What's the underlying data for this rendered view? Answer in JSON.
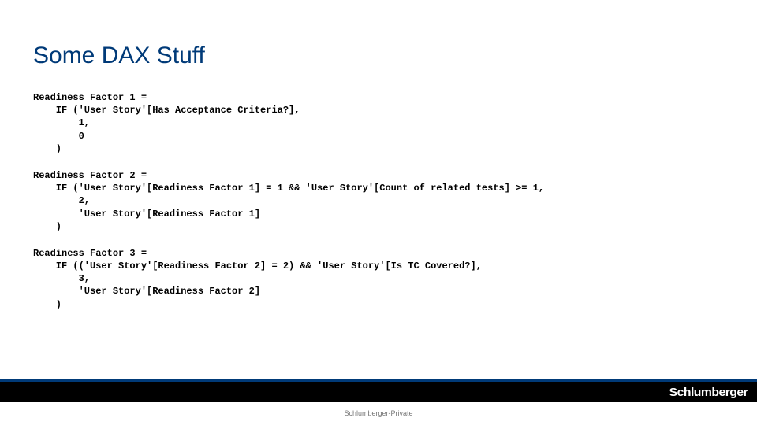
{
  "title": "Some DAX Stuff",
  "code_blocks": [
    "Readiness Factor 1 = \n    IF ('User Story'[Has Acceptance Criteria?],\n        1,\n        0\n    )",
    "Readiness Factor 2 = \n    IF ('User Story'[Readiness Factor 1] = 1 && 'User Story'[Count of related tests] >= 1,\n        2,\n        'User Story'[Readiness Factor 1]\n    )",
    "Readiness Factor 3 = \n    IF (('User Story'[Readiness Factor 2] = 2) && 'User Story'[Is TC Covered?],\n        3,\n        'User Story'[Readiness Factor 2]\n    )"
  ],
  "footer": {
    "brand": "Schlumberger",
    "confidential": "Schlumberger-Private"
  }
}
